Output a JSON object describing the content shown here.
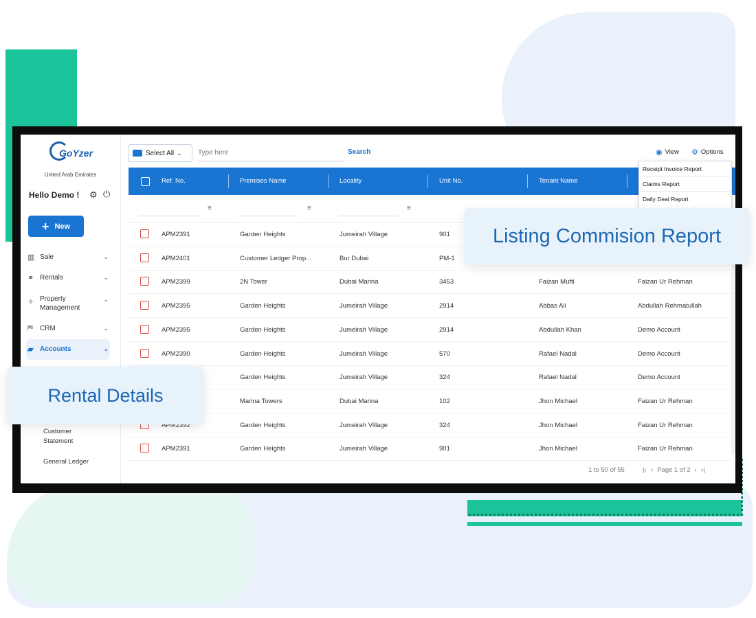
{
  "brand": {
    "name": "GoYzer",
    "region": "United Arab Emirates"
  },
  "sidebar": {
    "greeting": "Hello Demo !",
    "new_label": "New",
    "items": [
      {
        "label": "Sale",
        "icon": "bar-chart-icon"
      },
      {
        "label": "Rentals",
        "icon": "handshake-icon"
      },
      {
        "label": "Property Management",
        "icon": "puzzle-icon"
      },
      {
        "label": "CRM",
        "icon": "crm-icon"
      },
      {
        "label": "Accounts",
        "icon": "folder-icon",
        "active": true
      }
    ],
    "sub_items": [
      "Customer Statement",
      "General Ledger"
    ]
  },
  "toolbar": {
    "select_all": "Select All",
    "search_placeholder": "Type here",
    "search_label": "Search",
    "view_label": "View",
    "options_label": "Options"
  },
  "options_menu": [
    "Receipt Invoice Report",
    "Claims Report",
    "Daily Deal Report"
  ],
  "table": {
    "columns": [
      "Ref. No.",
      "Premises Name",
      "Locality",
      "Unit No.",
      "Tenant Name"
    ],
    "rows": [
      [
        "APM2391",
        "Garden Heights",
        "Jumeirah Village",
        "901",
        "",
        ""
      ],
      [
        "APM2401",
        "Customer Ledger Prop...",
        "Bur Dubai",
        "PM-1",
        "",
        ""
      ],
      [
        "APM2399",
        "2N Tower",
        "Dubai Marina",
        "3453",
        "Faizan Mufti",
        "Faizan Ur Rehman"
      ],
      [
        "APM2395",
        "Garden Heights",
        "Jumeirah Village",
        "2914",
        "Abbas Ali",
        "Abdullah Rehmatullah"
      ],
      [
        "APM2395",
        "Garden Heights",
        "Jumeirah Village",
        "2914",
        "Abdullah Khan",
        "Demo Account"
      ],
      [
        "APM2390",
        "Garden Heights",
        "Jumeirah Village",
        "570",
        "Rafael Nadal",
        "Demo Account"
      ],
      [
        "",
        "Garden Heights",
        "Jumeirah Village",
        "324",
        "Rafael Nadal",
        "Demo Account"
      ],
      [
        "",
        "Marina Towers",
        "Dubai Marina",
        "102",
        "Jhon Michael",
        "Faizan Ur Rehman"
      ],
      [
        "APM2392",
        "Garden Heights",
        "Jumeirah Village",
        "324",
        "Jhon Michael",
        "Faizan Ur Rehman"
      ],
      [
        "APM2391",
        "Garden Heights",
        "Jumeirah Village",
        "901",
        "Jhon Michael",
        "Faizan Ur Rehman"
      ]
    ]
  },
  "pagination": {
    "range": "1 to 50 of 55",
    "page": "Page 1 of 2"
  },
  "overlays": {
    "listing": "Listing Commision Report",
    "rental": "Rental Details"
  },
  "colors": {
    "primary": "#1a74d2",
    "accent_green": "#1bc49a",
    "overlay_text": "#1d68b3"
  }
}
